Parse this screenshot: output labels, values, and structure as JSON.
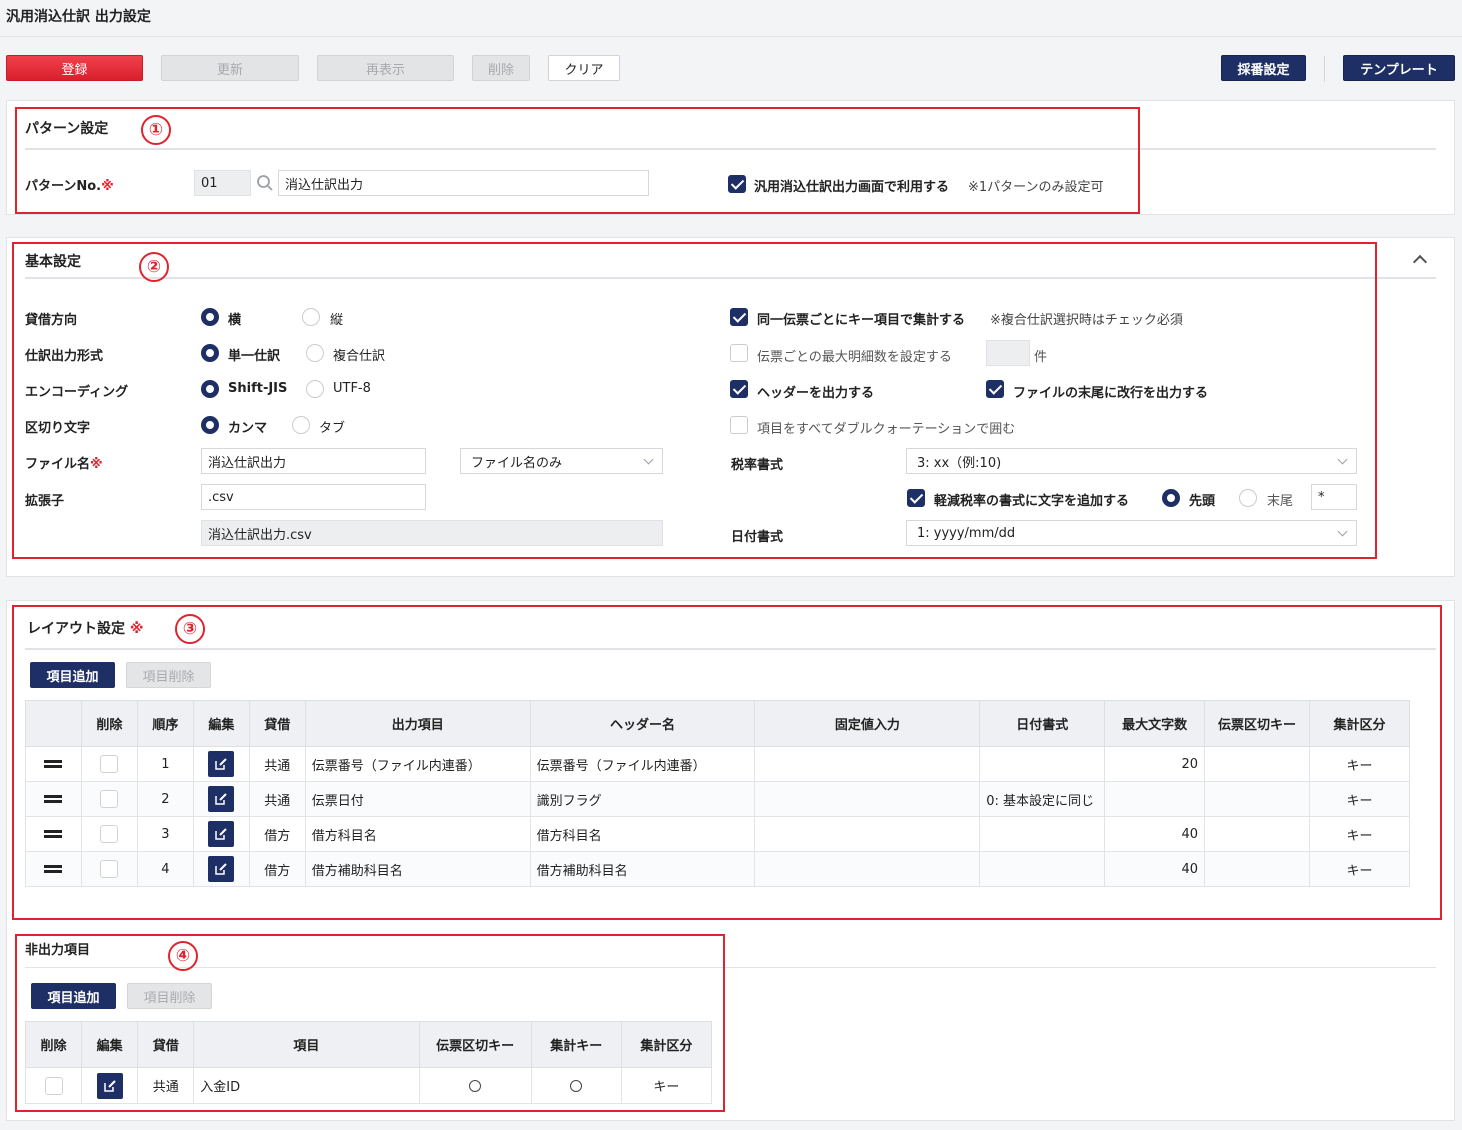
{
  "page_title": "汎用消込仕訳 出力設定",
  "toolbar": {
    "register": "登録",
    "update": "更新",
    "redisplay": "再表示",
    "delete": "削除",
    "clear": "クリア",
    "numbering": "採番設定",
    "template": "テンプレート"
  },
  "annotations": [
    "①",
    "②",
    "③",
    "④"
  ],
  "pattern": {
    "title": "パターン設定",
    "no_label": "パターンNo.",
    "required_mark": "※",
    "no_value": "01",
    "name_value": "消込仕訳出力",
    "use_label": "汎用消込仕訳出力画面で利用する",
    "use_checked": true,
    "use_note": "※1パターンのみ設定可"
  },
  "basic": {
    "title": "基本設定",
    "direction": {
      "label": "貸借方向",
      "opt1": "横",
      "opt2": "縦",
      "selected": "横"
    },
    "format": {
      "label": "仕訳出力形式",
      "opt1": "単一仕訳",
      "opt2": "複合仕訳",
      "selected": "単一仕訳"
    },
    "encoding": {
      "label": "エンコーディング",
      "opt1": "Shift-JIS",
      "opt2": "UTF-8",
      "selected": "Shift-JIS"
    },
    "delimiter": {
      "label": "区切り文字",
      "opt1": "カンマ",
      "opt2": "タブ",
      "selected": "カンマ"
    },
    "filename": {
      "label": "ファイル名",
      "required_mark": "※",
      "value": "消込仕訳出力",
      "mode": "ファイル名のみ"
    },
    "extension": {
      "label": "拡張子",
      "value": ".csv",
      "preview": "消込仕訳出力.csv"
    },
    "aggregate": {
      "label": "同一伝票ごとにキー項目で集計する",
      "checked": true,
      "note": "※複合仕訳選択時はチェック必須"
    },
    "max_details": {
      "label": "伝票ごとの最大明細数を設定する",
      "checked": false,
      "value": "",
      "unit": "件"
    },
    "header_out": {
      "label": "ヘッダーを出力する",
      "checked": true
    },
    "eol_out": {
      "label": "ファイルの末尾に改行を出力する",
      "checked": true
    },
    "quote_all": {
      "label": "項目をすべてダブルクォーテーションで囲む",
      "checked": false
    },
    "tax_format": {
      "label": "税率書式",
      "value": "3: xx（例:10)"
    },
    "reduced_tax": {
      "label": "軽減税率の書式に文字を追加する",
      "checked": true,
      "opt1": "先頭",
      "opt2": "末尾",
      "selected": "先頭",
      "char": "*"
    },
    "date_format": {
      "label": "日付書式",
      "value": "1: yyyy/mm/dd"
    }
  },
  "layout": {
    "title": "レイアウト設定",
    "required_mark": "※",
    "add_btn": "項目追加",
    "remove_btn": "項目削除",
    "headers": [
      "削除",
      "順序",
      "編集",
      "貸借",
      "出力項目",
      "ヘッダー名",
      "固定値入力",
      "日付書式",
      "最大文字数",
      "伝票区切キー",
      "集計区分"
    ],
    "rows": [
      {
        "order": "1",
        "dc": "共通",
        "item": "伝票番号（ファイル内連番）",
        "header": "伝票番号（ファイル内連番）",
        "fixed": "",
        "date": "",
        "max": "20",
        "key": "",
        "agg": "キー"
      },
      {
        "order": "2",
        "dc": "共通",
        "item": "伝票日付",
        "header": "識別フラグ",
        "fixed": "",
        "date": "0: 基本設定に同じ",
        "max": "",
        "key": "",
        "agg": "キー"
      },
      {
        "order": "3",
        "dc": "借方",
        "item": "借方科目名",
        "header": "借方科目名",
        "fixed": "",
        "date": "",
        "max": "40",
        "key": "",
        "agg": "キー"
      },
      {
        "order": "4",
        "dc": "借方",
        "item": "借方補助科目名",
        "header": "借方補助科目名",
        "fixed": "",
        "date": "",
        "max": "40",
        "key": "",
        "agg": "キー"
      }
    ]
  },
  "nonoutput": {
    "title": "非出力項目",
    "add_btn": "項目追加",
    "remove_btn": "項目削除",
    "headers": [
      "削除",
      "編集",
      "貸借",
      "項目",
      "伝票区切キー",
      "集計キー",
      "集計区分"
    ],
    "rows": [
      {
        "dc": "共通",
        "item": "入金ID",
        "agg": "キー"
      }
    ]
  }
}
